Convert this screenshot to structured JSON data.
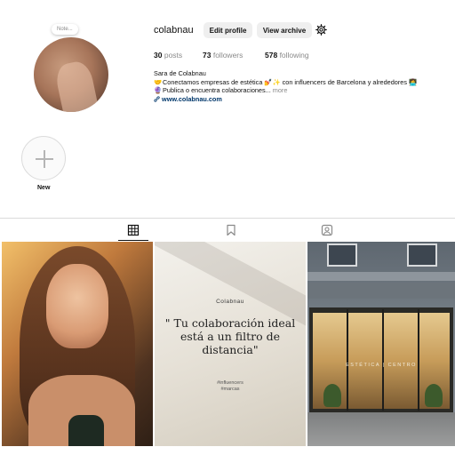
{
  "profile": {
    "note_label": "Note...",
    "username": "colabnau",
    "edit_profile_label": "Edit profile",
    "view_archive_label": "View archive",
    "settings_icon": "gear-icon"
  },
  "stats": {
    "posts": {
      "count": "30",
      "label": "posts"
    },
    "followers": {
      "count": "73",
      "label": "followers"
    },
    "following": {
      "count": "578",
      "label": "following"
    }
  },
  "bio": {
    "name": "Sara de Colabnau",
    "line1_emoji": "🤝",
    "line1": "Conectamos empresas de estética",
    "line1_emoji2": "💅✨",
    "line1_tail": "con influencers de Barcelona y alrededores",
    "line1_emoji3": "👩‍💻",
    "line2_emoji": "🔮",
    "line2": "Publica o encuentra colaboraciones...",
    "more_label": "more",
    "link_icon": "link-icon",
    "link": "www.colabnau.com"
  },
  "highlights": {
    "new_label": "New"
  },
  "tabs": {
    "posts_icon": "grid-icon",
    "saved_icon": "bookmark-icon",
    "tagged_icon": "tagged-user-icon",
    "active": "posts"
  },
  "posts": [
    {
      "type": "photo",
      "subject": "portrait"
    },
    {
      "type": "quote",
      "brand": "Colabnau",
      "quote": "\" Tu colaboración ideal está a un filtro de distancia\"",
      "tags_line1": "#influencers",
      "tags_line2": "#marcas"
    },
    {
      "type": "photo",
      "subject": "storefront",
      "sign": "ESTÉTICA | CENTRO"
    }
  ],
  "colors": {
    "link": "#00376b",
    "muted": "#8a8a8a",
    "button_bg": "#efefef"
  }
}
